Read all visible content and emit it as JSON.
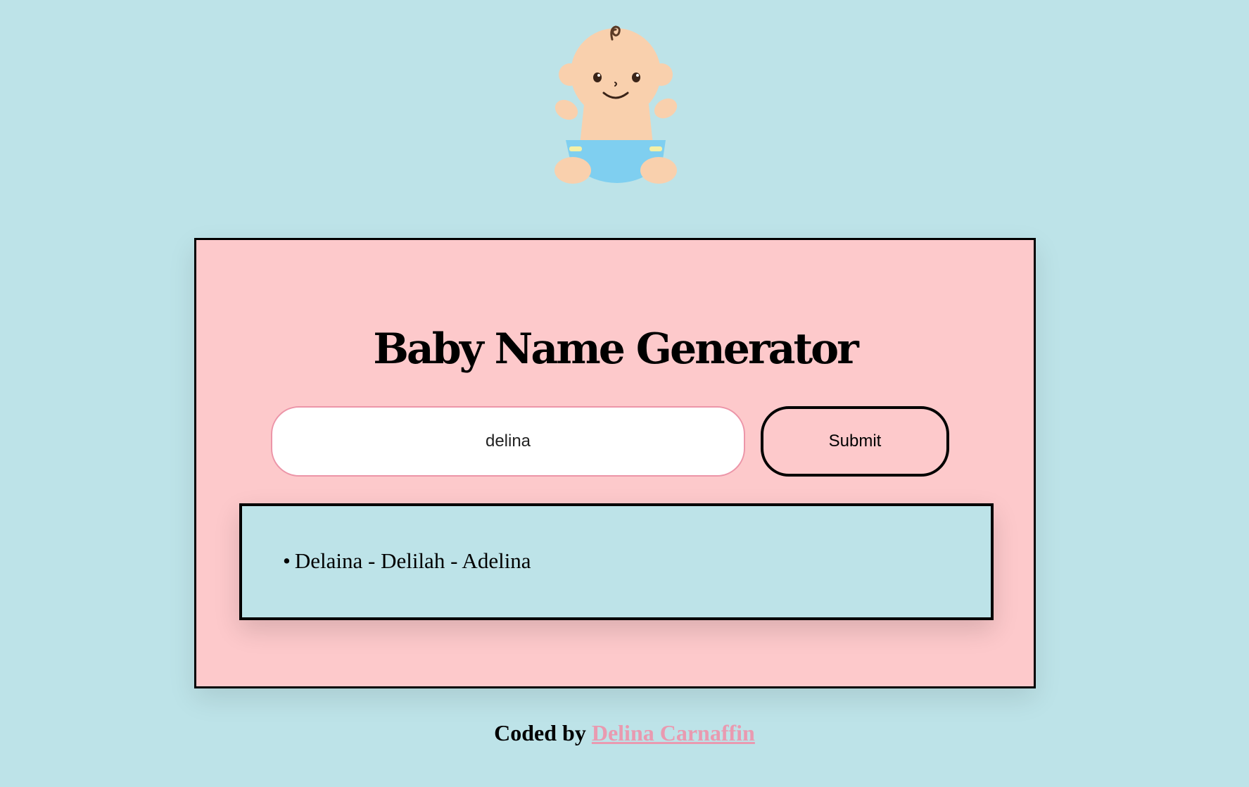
{
  "header": {
    "illustration": "baby-icon"
  },
  "generator": {
    "title": "Baby Name Generator",
    "input_value": "delina",
    "submit_label": "Submit",
    "results": [
      {
        "bullet": "•",
        "text": "Delaina - Delilah - Adelina"
      }
    ]
  },
  "footer": {
    "prefix": "Coded by",
    "author_link": "Delina Carnaffin"
  },
  "colors": {
    "page_background": "#bde3e8",
    "card_background": "#fdc9cb",
    "input_border": "#ec95a8",
    "link": "#e99ab0",
    "diaper": "#7fcff0",
    "skin": "#f9d0ad"
  }
}
